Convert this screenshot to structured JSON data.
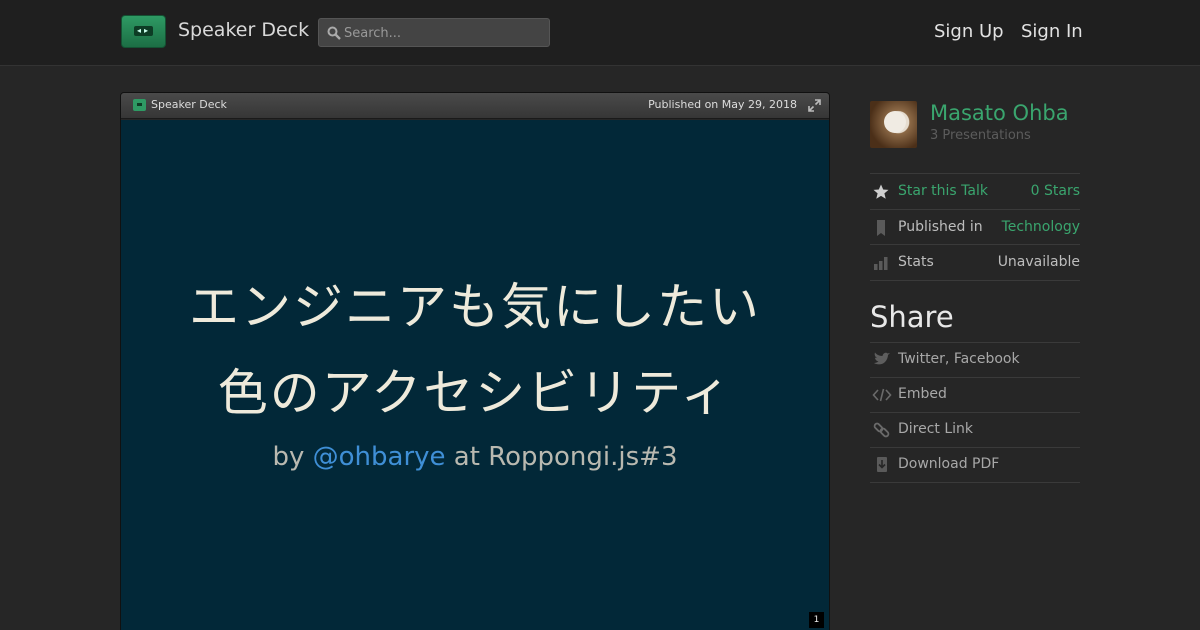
{
  "header": {
    "brand": "Speaker Deck",
    "search_placeholder": "Search...",
    "sign_up": "Sign Up",
    "sign_in": "Sign In"
  },
  "player": {
    "brand": "Speaker Deck",
    "published": "Published on May 29, 2018",
    "page_number": "1"
  },
  "slide": {
    "title_line1": "エンジニアも気にしたい",
    "title_line2": "色のアクセシビリティ",
    "sub_prefix": "by ",
    "sub_handle": "@ohbarye",
    "sub_suffix": " at Roppongi.js#3"
  },
  "author": {
    "name": "Masato Ohba",
    "presentations": "3 Presentations"
  },
  "details": [
    {
      "icon": "star-icon",
      "label": "Star this Talk",
      "value": "0 Stars"
    },
    {
      "icon": "bookmark-icon",
      "label": "Published in",
      "value": "Technology"
    },
    {
      "icon": "stats-icon",
      "label": "Stats",
      "value": "Unavailable"
    }
  ],
  "share": {
    "heading": "Share",
    "items": [
      {
        "icon": "bird-icon",
        "label": "Twitter, Facebook"
      },
      {
        "icon": "code-icon",
        "label": "Embed"
      },
      {
        "icon": "link-icon",
        "label": "Direct Link"
      },
      {
        "icon": "download-icon",
        "label": "Download PDF"
      }
    ]
  },
  "colors": {
    "accent_green": "#3aa56e",
    "slide_background": "#022838",
    "handle_blue": "#3f8fd6"
  }
}
